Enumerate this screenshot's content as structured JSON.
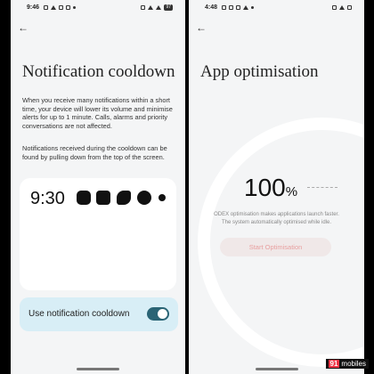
{
  "left": {
    "status_time": "9:46",
    "battery": "97",
    "title": "Notification cooldown",
    "para1": "When you receive many notifications within a short time, your device will lower its volume and minimise alerts for up to 1 minute. Calls, alarms and priority conversations are not affected.",
    "para2": "Notifications received during the cooldown can be found by pulling down from the top of the screen.",
    "preview_time": "9:30",
    "toggle_label": "Use notification cooldown",
    "toggle_on": true
  },
  "right": {
    "status_time": "4:48",
    "title": "App optimisation",
    "percent": "100",
    "percent_sign": "%",
    "desc1": "ODEX optimisation makes applications launch faster.",
    "desc2": "The system automatically optimised while idle.",
    "button": "Start Optimisation"
  },
  "watermark": {
    "brand_num": "91",
    "brand_text": "mobiles"
  }
}
